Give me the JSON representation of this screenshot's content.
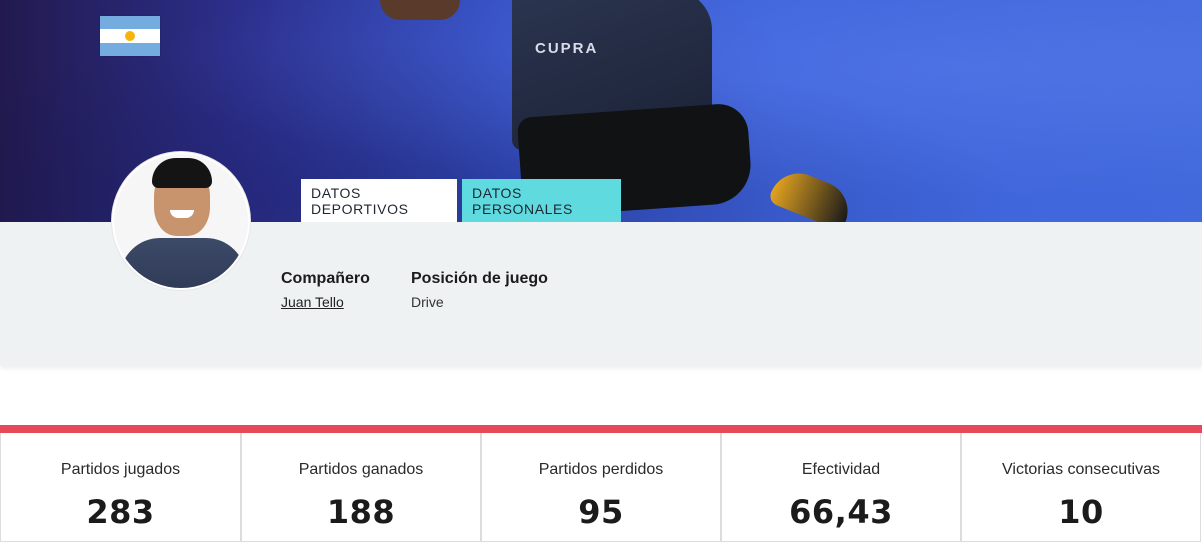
{
  "flag": {
    "country": "argentina",
    "colors": {
      "blue": "#74acdf",
      "white": "#ffffff",
      "sun": "#f6b40e"
    }
  },
  "hero": {
    "shirt_logo": "CUPRA"
  },
  "tabs": [
    {
      "label": "DATOS DEPORTIVOS",
      "active": false
    },
    {
      "label": "DATOS PERSONALES",
      "active": true
    }
  ],
  "fields": {
    "companero": {
      "label": "Compañero",
      "value": "Juan Tello"
    },
    "posicion": {
      "label": "Posición de juego",
      "value": "Drive"
    }
  },
  "stats": [
    {
      "label": "Partidos jugados",
      "value": "283"
    },
    {
      "label": "Partidos ganados",
      "value": "188"
    },
    {
      "label": "Partidos perdidos",
      "value": "95"
    },
    {
      "label": "Efectividad",
      "value": "66,43"
    },
    {
      "label": "Victorias consecutivas",
      "value": "10"
    }
  ],
  "colors": {
    "accent_bar": "#e8495a",
    "active_tab": "#5fdbe0",
    "panel_bg": "#eef2f2"
  }
}
